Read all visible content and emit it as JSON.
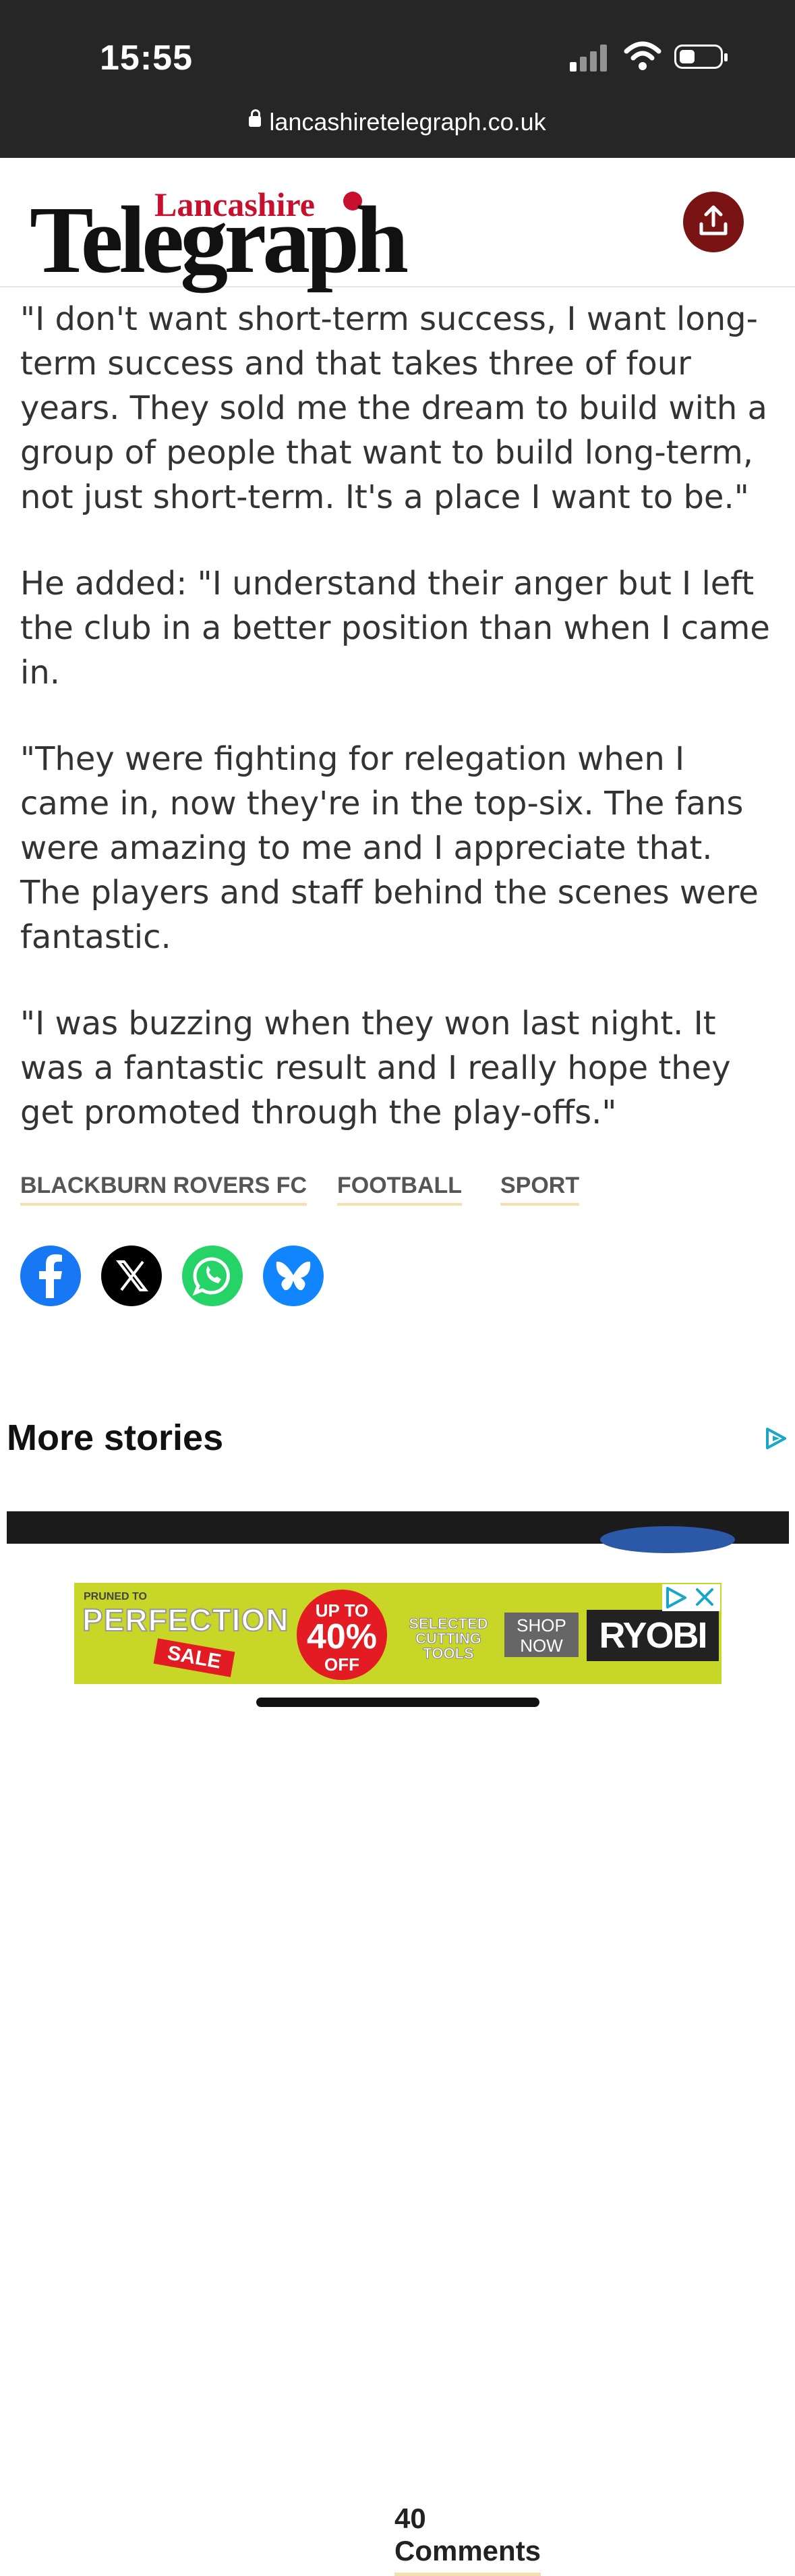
{
  "status": {
    "time": "15:55",
    "url": "lancashiretelegraph.co.uk"
  },
  "header": {
    "logo_top": "Lancashire",
    "logo_main": "Telegraph"
  },
  "article": {
    "paragraphs": [
      "\"I don't want short-term success, I want long-term success and that takes three of four years. They sold me the dream to build with a group of people that want to build long-term, not just short-term. It's a place I want to be.\"",
      "He added: \"I understand their anger but I left the club in a better position than when I came in.",
      "\"They were fighting for relegation when I came in, now they're in the top-six. The fans were amazing to me and I appreciate that. The players and staff behind the scenes were fantastic.",
      "\"I was buzzing when they won last night. It was a fantastic result and I really hope they get promoted through the play-offs.\""
    ]
  },
  "tags": [
    "BLACKBURN ROVERS FC",
    "FOOTBALL",
    "SPORT"
  ],
  "social": {
    "comments_label": "40 Comments",
    "colors": {
      "facebook": "#1877f2",
      "x": "#000000",
      "whatsapp": "#25d366",
      "bluesky": "#1185fe"
    }
  },
  "more_stories": {
    "title": "More stories"
  },
  "ad": {
    "pruned": "PRUNED TO",
    "perfection": "PERFECTION",
    "sale": "SALE",
    "upto": "UP TO",
    "percent": "40%",
    "off": "OFF",
    "selected": "SELECTED CUTTING TOOLS",
    "shop": "SHOP NOW",
    "brand": "RYOBI"
  },
  "colors": {
    "accent": "#7a1414",
    "logo_red": "#c8102e",
    "tag_underline": "#f5dfb0"
  }
}
